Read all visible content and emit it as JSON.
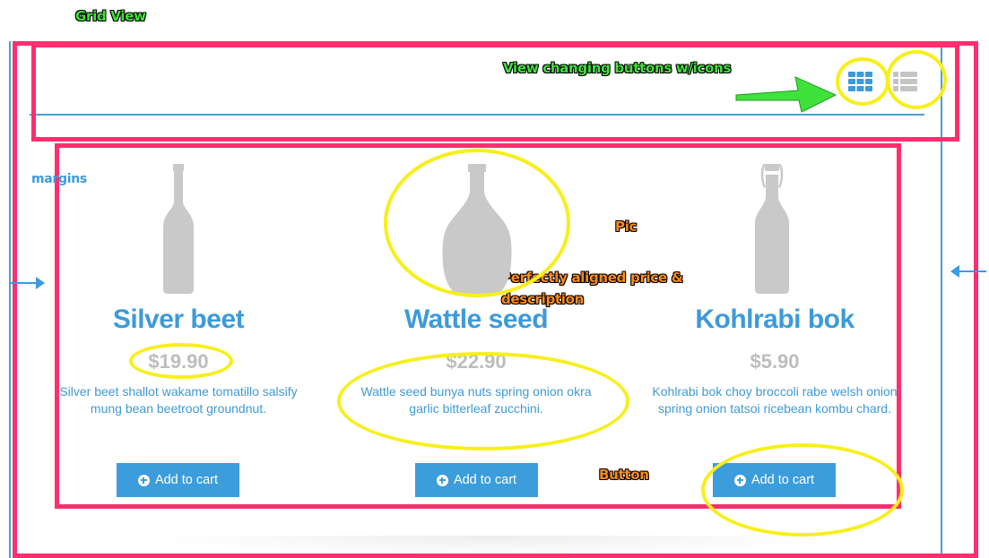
{
  "annotations": {
    "grid_view": "Grid View",
    "view_buttons": "View changing buttons w/icons",
    "margins": "margins",
    "pic": "Pic",
    "aligned": "Perfectly aligned price & description",
    "button": "Button"
  },
  "view_toggle": {
    "grid_icon": "grid-view-icon",
    "list_icon": "list-view-icon",
    "active": "grid"
  },
  "products": [
    {
      "name": "Silver beet",
      "price": "$19.90",
      "description": "Silver beet shallot wakame tomatillo salsify mung bean beetroot groundnut.",
      "button_label": "Add to cart",
      "image_icon": "wine-bottle-icon"
    },
    {
      "name": "Wattle seed",
      "price": "$22.90",
      "description": "Wattle seed bunya nuts spring onion okra garlic bitterleaf zucchini.",
      "button_label": "Add to cart",
      "image_icon": "liquor-bottle-icon"
    },
    {
      "name": "Kohlrabi bok",
      "price": "$5.90",
      "description": "Kohlrabi bok choy broccoli rabe welsh onion spring onion tatsoi ricebean kombu chard.",
      "button_label": "Add to cart",
      "image_icon": "swing-top-bottle-icon"
    }
  ],
  "colors": {
    "accent": "#3d9ad9",
    "price": "#bdbdbd",
    "annotation_box": "#ff2e6d",
    "highlight": "#f7ef1b",
    "annotation_green": "#3fe23a",
    "annotation_orange": "#ff8c1a"
  }
}
